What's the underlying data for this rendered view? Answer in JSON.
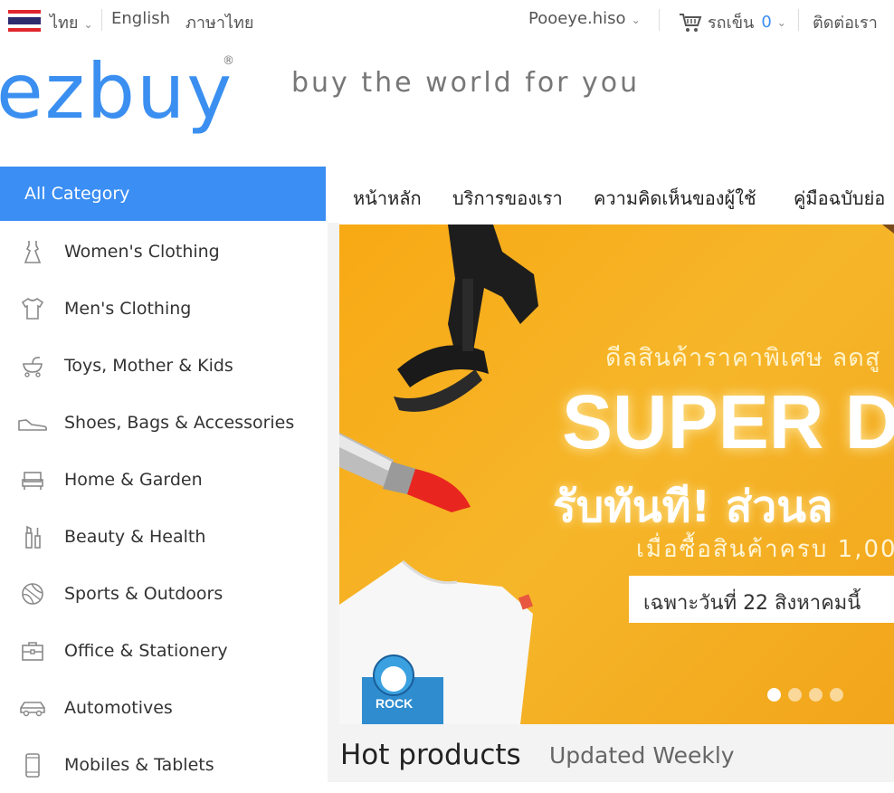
{
  "topbar": {
    "lang_thai": "ไทย",
    "lang_english": "English",
    "lang_thai_native": "ภาษาไทย",
    "username": "Pooeye.hiso",
    "cart_label": "รถเข็น",
    "cart_count": "0",
    "contact": "ติดต่อเรา"
  },
  "brand": {
    "logo": "ezbuy",
    "registered": "®",
    "tagline": "buy the world for you",
    "color": "#3b8ef3"
  },
  "sidebar": {
    "header": "All Category",
    "items": [
      {
        "label": "Women's Clothing",
        "icon": "dress-icon"
      },
      {
        "label": "Men's Clothing",
        "icon": "shirt-icon"
      },
      {
        "label": "Toys, Mother & Kids",
        "icon": "stroller-icon"
      },
      {
        "label": "Shoes, Bags & Accessories",
        "icon": "shoe-icon"
      },
      {
        "label": "Home & Garden",
        "icon": "sofa-icon"
      },
      {
        "label": "Beauty & Health",
        "icon": "cosmetics-icon"
      },
      {
        "label": "Sports & Outdoors",
        "icon": "ball-icon"
      },
      {
        "label": "Office & Stationery",
        "icon": "briefcase-icon"
      },
      {
        "label": "Automotives",
        "icon": "car-icon"
      },
      {
        "label": "Mobiles & Tablets",
        "icon": "phone-icon"
      }
    ]
  },
  "nav": {
    "items": [
      "หน้าหลัก",
      "บริการของเรา",
      "ความคิดเห็นของผู้ใช้",
      "คู่มือฉบับย่อ"
    ]
  },
  "banner": {
    "subtitle": "ดีลสินค้าราคาพิเศษ ลดสู",
    "headline": "SUPER D",
    "line2": "รับทันที! ส่วนล",
    "line3": "เมื่อซื้อสินค้าครบ 1,00",
    "box_text": "เฉพาะวันที่ 22 สิงหาคมนี้",
    "slide_count": 4,
    "active_slide": 1
  },
  "hot": {
    "title": "Hot products",
    "subtitle": "Updated Weekly"
  }
}
